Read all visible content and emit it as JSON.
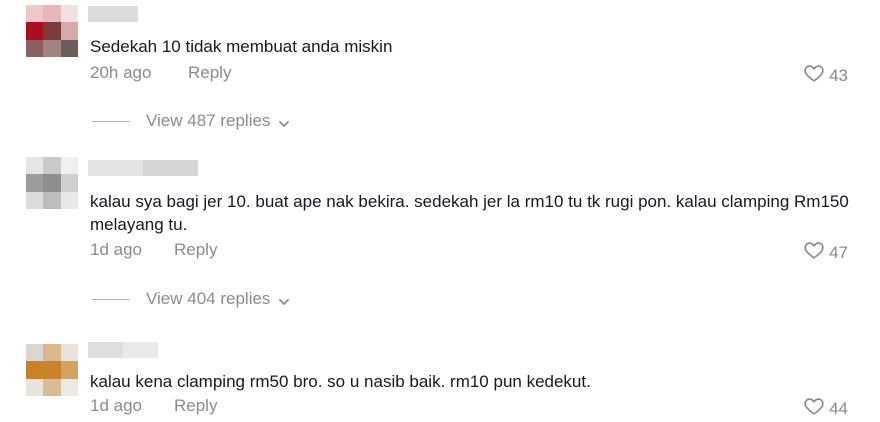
{
  "comments": [
    {
      "text": "Sedekah 10 tidak membuat anda miskin",
      "time": "20h ago",
      "reply_label": "Reply",
      "likes": "43",
      "view_replies": "View 487 replies",
      "avatar_colors": [
        "#eec8c8",
        "#e7b6b6",
        "#f3e0e0",
        "#a90f1e",
        "#7d3a3a",
        "#d7a9a9",
        "#8a6060",
        "#a58282",
        "#6c5d5d"
      ]
    },
    {
      "text": "kalau sya bagi jer 10. buat ape nak bekira. sedekah jer la rm10 tu tk rugi pon. kalau clamping Rm150 melayang tu.",
      "time": "1d ago",
      "reply_label": "Reply",
      "likes": "47",
      "view_replies": "View 404 replies",
      "avatar_colors": [
        "#e5e5e5",
        "#c9c9c9",
        "#efefef",
        "#9c9c9c",
        "#8e8e8e",
        "#cfcfcf",
        "#dcdcdc",
        "#bdbdbd",
        "#e8e8e8"
      ]
    },
    {
      "text": "kalau kena clamping rm50 bro. so u nasib baik. rm10 pun kedekut.",
      "time": "1d ago",
      "reply_label": "Reply",
      "likes": "44",
      "avatar_colors": [
        "#ddd6cf",
        "#d9b98c",
        "#e7e2dc",
        "#c9822a",
        "#c8832d",
        "#d0a363",
        "#e7e3df",
        "#d8bc96",
        "#ece9e5"
      ]
    }
  ]
}
